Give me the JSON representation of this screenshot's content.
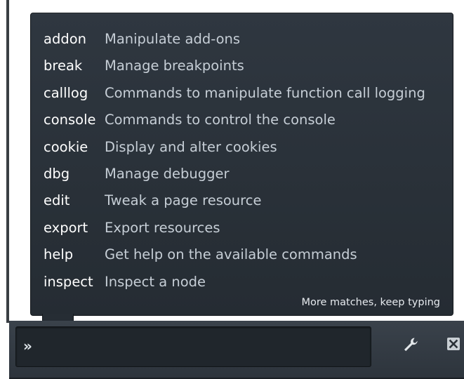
{
  "popup": {
    "commands": [
      {
        "name": "addon",
        "description": "Manipulate add-ons"
      },
      {
        "name": "break",
        "description": "Manage breakpoints"
      },
      {
        "name": "calllog",
        "description": "Commands to manipulate function call logging"
      },
      {
        "name": "console",
        "description": "Commands to control the console"
      },
      {
        "name": "cookie",
        "description": "Display and alter cookies"
      },
      {
        "name": "dbg",
        "description": "Manage debugger"
      },
      {
        "name": "edit",
        "description": "Tweak a page resource"
      },
      {
        "name": "export",
        "description": "Export resources"
      },
      {
        "name": "help",
        "description": "Get help on the available commands"
      },
      {
        "name": "inspect",
        "description": "Inspect a node"
      }
    ],
    "more_text": "More matches, keep typing"
  },
  "toolbar": {
    "prompt": "»",
    "input_value": "",
    "wrench_icon": "wrench-icon",
    "close_icon": "close-icon"
  },
  "colors": {
    "popup_bg": "#2b333b",
    "command_name": "#ffffff",
    "command_desc": "#c6ced6",
    "toolbar_bg": "#343b43"
  }
}
